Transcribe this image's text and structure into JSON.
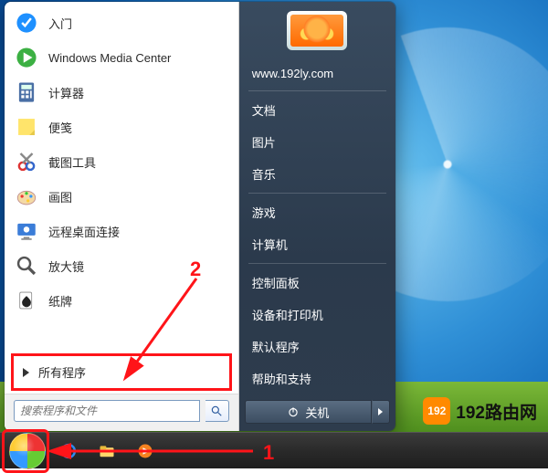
{
  "start_menu": {
    "programs": [
      {
        "label": "入门",
        "icon": "intro-icon"
      },
      {
        "label": "Windows Media Center",
        "icon": "media-center-icon"
      },
      {
        "label": "计算器",
        "icon": "calculator-icon"
      },
      {
        "label": "便笺",
        "icon": "sticky-notes-icon"
      },
      {
        "label": "截图工具",
        "icon": "snipping-tool-icon"
      },
      {
        "label": "画图",
        "icon": "paint-icon"
      },
      {
        "label": "远程桌面连接",
        "icon": "remote-desktop-icon"
      },
      {
        "label": "放大镜",
        "icon": "magnifier-icon"
      },
      {
        "label": "纸牌",
        "icon": "solitaire-icon"
      }
    ],
    "all_programs_label": "所有程序",
    "search_placeholder": "搜索程序和文件",
    "right": {
      "username": "www.192ly.com",
      "items_top": [
        "文档",
        "图片",
        "音乐"
      ],
      "items_mid": [
        "游戏",
        "计算机"
      ],
      "items_bottom": [
        "控制面板",
        "设备和打印机",
        "默认程序",
        "帮助和支持"
      ]
    },
    "shutdown_label": "关机"
  },
  "taskbar": {
    "pinned": [
      {
        "name": "ie-icon"
      },
      {
        "name": "explorer-icon"
      },
      {
        "name": "media-player-icon"
      }
    ]
  },
  "annotations": {
    "label1": "1",
    "label2": "2"
  },
  "watermark": {
    "badge": "192",
    "text": "192路由网"
  }
}
